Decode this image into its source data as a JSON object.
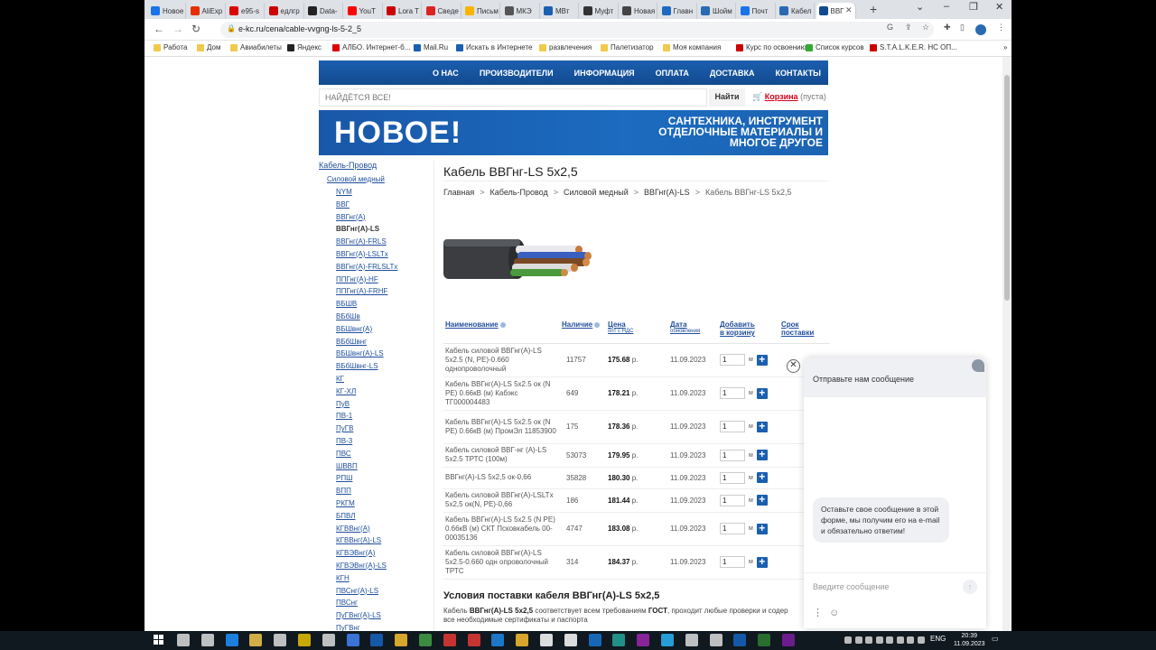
{
  "browser": {
    "tabs": [
      "Новое",
      "AliExp",
      "e95-s",
      "eдлгр",
      "Data-",
      "YouT",
      "Lora T",
      "Сведе",
      "Письм",
      "МКЭ",
      "МВт",
      "Муфт",
      "Новая",
      "Главн",
      "Шойм",
      "Почт",
      "Кабел",
      "ВВГ"
    ],
    "url": "e-kc.ru/cena/cable-vvgng-ls-5-2_5",
    "bookmarks": [
      "Работа",
      "Дом",
      "Авиабилеты",
      "Яндекс",
      "АЛБО. Интернет-б...",
      "Mail.Ru",
      "Искать в Интернете",
      "развлечения",
      "Палетизатор",
      "Моя компания",
      "Курс по освоению...",
      "Список курсов",
      "S.T.A.L.K.E.R. НС ОП..."
    ]
  },
  "site": {
    "nav": [
      "О НАС",
      "ПРОИЗВОДИТЕЛИ",
      "ИНФОРМАЦИЯ",
      "ОПЛАТА",
      "ДОСТАВКА",
      "КОНТАКТЫ"
    ],
    "search_placeholder": "НАЙДЁТСЯ ВСЕ!",
    "search_button": "Найти",
    "cart_link": "Корзина",
    "cart_status": "(пуста)",
    "banner_big": "НОВОЕ!",
    "banner_sub": "САНТЕХНИКА, ИНСТРУМЕНТ ОТДЕЛОЧНЫЕ МАТЕРИАЛЫ И МНОГОЕ ДРУГОЕ"
  },
  "sidebar": {
    "root": "Кабель-Провод",
    "sub": "Силовой медный",
    "items": [
      "NYM",
      "ВВГ",
      "ВВГнг(А)",
      "ВВГнг(А)-LS",
      "ВВГнг(А)-FRLS",
      "ВВГнг(А)-LSLTx",
      "ВВГнг(А)-FRLSLTx",
      "ППГнг(А)-HF",
      "ППГнг(А)-FRHF",
      "ВБШВ",
      "ВБбШв",
      "ВБШвнг(А)",
      "ВБбШвнг",
      "ВБШвнг(А)-LS",
      "ВБбШвнг-LS",
      "КГ",
      "КГ-ХЛ",
      "ПуВ",
      "ПВ-1",
      "ПуГВ",
      "ПВ-3",
      "ПВС",
      "ШВВП",
      "РПШ",
      "ВПП",
      "РКГМ",
      "БПВЛ",
      "КГВВнг(А)",
      "КГВВнг(А)-LS",
      "КГВЭВнг(А)",
      "КГВЭВнг(А)-LS",
      "КГН",
      "ПВСнг(А)-LS",
      "ПВСнг",
      "ПуГВнг(А)-LS",
      "ПуГВнг"
    ],
    "active_index": 3
  },
  "content": {
    "title": "Кабель ВВГнг-LS 5х2,5",
    "breadcrumb": [
      "Главная",
      "Кабель-Провод",
      "Силовой медный",
      "ВВГнг(А)-LS",
      "Кабель ВВГнг-LS 5х2,5"
    ],
    "table": {
      "headers": {
        "name": "Наименование",
        "stock": "Наличие",
        "price": "Цена",
        "price_sub": "опт с НДС",
        "date": "Дата",
        "date_sub": "обновления",
        "add": "Добавить",
        "add2": "в корзину",
        "delivery": "Срок",
        "delivery2": "поставки"
      },
      "rows": [
        {
          "name": "Кабель силовой ВВГнг(А)-LS 5х2.5 (N, PE)-0.660 однопроволочный",
          "stock": "11757",
          "price": "175.68",
          "currency": "р.",
          "date": "11.09.2023",
          "qty": "1",
          "unit": "м"
        },
        {
          "name": "Кабель ВВГнг(А)-LS 5х2.5 ок (N PE) 0.66кВ (м) Кабэкс ТГ000004483",
          "stock": "649",
          "price": "178.21",
          "currency": "р.",
          "date": "11.09.2023",
          "qty": "1",
          "unit": "м"
        },
        {
          "name": "Кабель ВВГнг(А)-LS 5х2.5 ок (N PE) 0.66кВ (м) ПромЭл 11853900",
          "stock": "175",
          "price": "178.36",
          "currency": "р.",
          "date": "11.09.2023",
          "qty": "1",
          "unit": "м"
        },
        {
          "name": "Кабель силовой ВВГ-нг (А)-LS 5х2.5 ТРТС (100м)",
          "stock": "53073",
          "price": "179.95",
          "currency": "р.",
          "date": "11.09.2023",
          "qty": "1",
          "unit": "м"
        },
        {
          "name": "ВВГнг(А)-LS 5х2,5 ок-0,66",
          "stock": "35828",
          "price": "180.30",
          "currency": "р.",
          "date": "11.09.2023",
          "qty": "1",
          "unit": "м"
        },
        {
          "name": "Кабель силовой ВВГнг(А)-LSLTx 5х2,5 ок(N, PE)-0,66",
          "stock": "186",
          "price": "181.44",
          "currency": "р.",
          "date": "11.09.2023",
          "qty": "1",
          "unit": "м"
        },
        {
          "name": "Кабель ВВГнг(А)-LS 5х2.5 (N PE) 0.66кВ (м) СКТ Псковкабель 00-00035136",
          "stock": "4747",
          "price": "183.08",
          "currency": "р.",
          "date": "11.09.2023",
          "qty": "1",
          "unit": "м"
        },
        {
          "name": "Кабель силовой ВВГнг(А)-LS 5х2.5-0.660 одн опроволочный ТРТС",
          "stock": "314",
          "price": "184.37",
          "currency": "р.",
          "date": "11.09.2023",
          "qty": "1",
          "unit": "м"
        }
      ]
    },
    "conditions_title": "Условия поставки кабеля ВВГнг(А)-LS 5х2,5",
    "conditions_text": {
      "pre": "Кабель ",
      "bold1": "ВВГнг(А)-LS 5х2,5",
      "mid": " соответствует всем требованиям ",
      "bold2": "ГОСТ",
      "post": ", проходит любые проверки и содер",
      "line2": "все необходимые сертификаты и паспорта"
    }
  },
  "chat": {
    "header": "Отправьте нам сообщение",
    "bubble": "Оставьте свое сообщение в этой форме, мы получим его на e-mail и обязательно ответим!",
    "input_placeholder": "Введите сообщение"
  },
  "taskbar": {
    "lang": "ENG",
    "time": "20:39",
    "date": "11.09.2023"
  },
  "colors": {
    "brand_blue": "#1b5faf",
    "cart_red": "#d0021b",
    "link_blue": "#1f4e9c"
  }
}
